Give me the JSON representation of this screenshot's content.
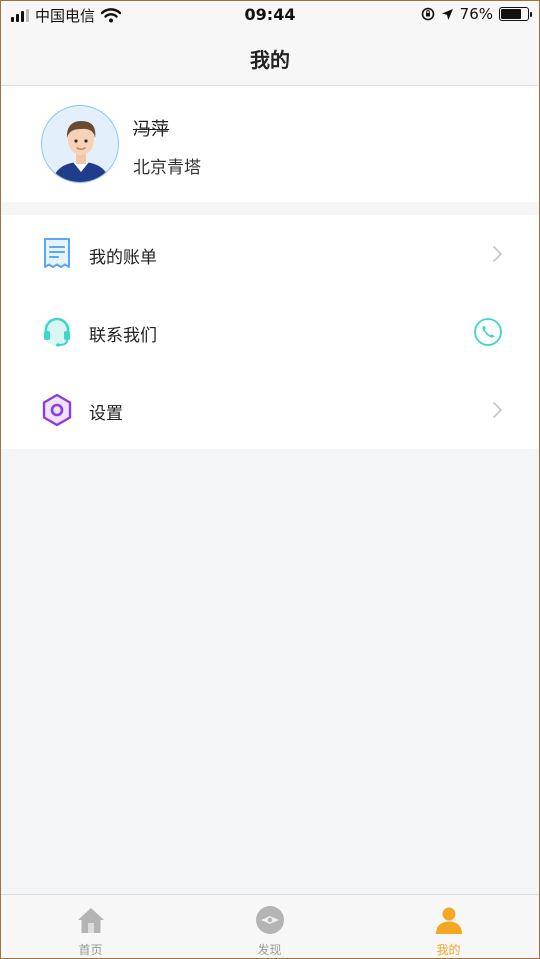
{
  "status_bar": {
    "carrier": "中国电信",
    "time": "09:44",
    "battery": "76%",
    "battery_level": 0.76,
    "signal_bars": 3
  },
  "header": {
    "title": "我的"
  },
  "profile": {
    "name": "冯萍",
    "organization": "北京青塔",
    "avatar_icon": "user-avatar-icon"
  },
  "menu": {
    "items": [
      {
        "label": "我的账单",
        "icon": "bill-icon",
        "trailing": "chevron-right-icon"
      },
      {
        "label": "联系我们",
        "icon": "headset-icon",
        "trailing": "phone-icon"
      },
      {
        "label": "设置",
        "icon": "settings-icon",
        "trailing": "chevron-right-icon"
      }
    ]
  },
  "tab_bar": {
    "active": "我的",
    "tabs": [
      {
        "label": "首页",
        "icon": "home-icon"
      },
      {
        "label": "发现",
        "icon": "discover-icon"
      },
      {
        "label": "我的",
        "icon": "profile-icon"
      }
    ]
  },
  "colors": {
    "accent": "#f5a623",
    "tab_inactive": "#9a9a9a",
    "page_background": "#f4f5f7",
    "bill_icon": "#5aa8f0",
    "headset_icon": "#3dd6c8",
    "settings_icon": "#8a3ee0"
  }
}
